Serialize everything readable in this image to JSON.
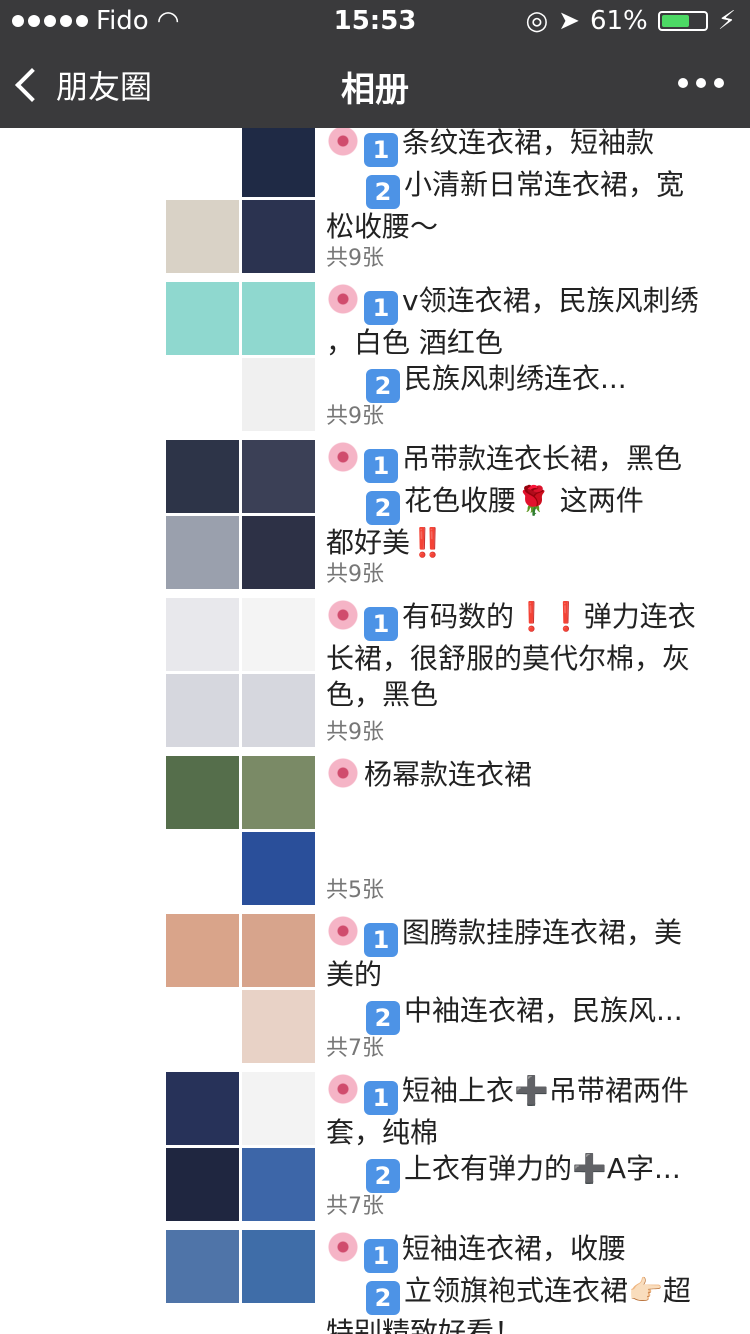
{
  "status": {
    "carrier": "Fido",
    "time": "15:53",
    "battery": "61%"
  },
  "nav": {
    "back_label": "朋友圈",
    "title": "相册"
  },
  "posts": [
    {
      "lines": [
        "条纹连衣裙，短袖款",
        "小清新日常连衣裙，宽",
        "松收腰～"
      ],
      "count": "共9张",
      "colors": [
        "#ffffff",
        "#1f2a45",
        "#d9d2c6",
        "#2b3350"
      ]
    },
    {
      "lines": [
        "v领连衣裙，民族风刺绣",
        "，白色 酒红色",
        "民族风刺绣连衣..."
      ],
      "count": "共9张",
      "colors": [
        "#8fd8cf",
        "#8fd8cf",
        "#ffffff",
        "#f0f0f0"
      ]
    },
    {
      "lines": [
        "吊带款连衣长裙，黑色",
        "花色收腰🌹   这两件",
        "都好美‼️"
      ],
      "count": "共9张",
      "colors": [
        "#2d3448",
        "#3b4056",
        "#9aa0ad",
        "#2d3146"
      ]
    },
    {
      "lines": [
        "有码数的❗️❗️弹力连衣",
        "长裙，很舒服的莫代尔棉，灰",
        "色，黑色"
      ],
      "count": "共9张",
      "colors": [
        "#e8e8ec",
        "#f4f4f4",
        "#d6d7de",
        "#d6d7de"
      ]
    },
    {
      "lines": [
        "杨幂款连衣裙"
      ],
      "count": "共5张",
      "colors": [
        "#556e4b",
        "#7a8a66",
        "#ffffff",
        "#2a4f9a"
      ]
    },
    {
      "lines": [
        "图腾款挂脖连衣裙，美",
        "美的",
        "中袖连衣裙，民族风..."
      ],
      "count": "共7张",
      "colors": [
        "#d9a48a",
        "#d7a48c",
        "#ffffff",
        "#e8d2c6"
      ]
    },
    {
      "lines": [
        "短袖上衣➕吊带裙两件",
        "套，纯棉",
        "上衣有弹力的➕A字..."
      ],
      "count": "共7张",
      "colors": [
        "#273259",
        "#f3f3f3",
        "#1f2640",
        "#3d66a8"
      ]
    },
    {
      "lines": [
        "短袖连衣裙，收腰",
        "立领旗袍式连衣裙👉🏻超",
        "特别精致好看！"
      ],
      "count": "",
      "colors": [
        "#4f74a8",
        "#3f6da8",
        "#ffffff",
        "#ffffff"
      ]
    }
  ]
}
